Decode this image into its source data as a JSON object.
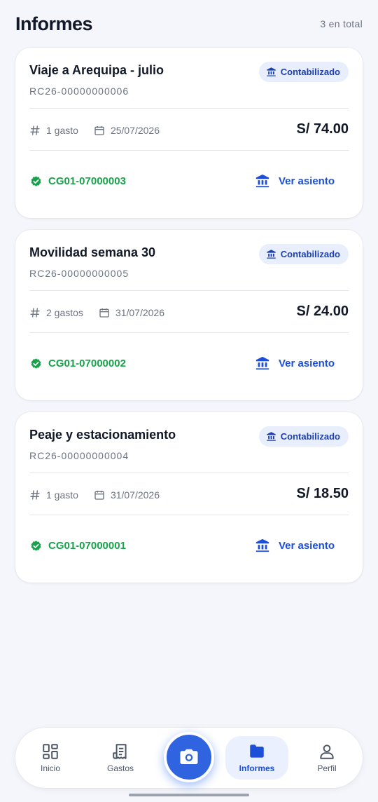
{
  "header": {
    "title": "Informes",
    "count": "3 en total"
  },
  "reports": [
    {
      "title": "Viaje a Arequipa - julio",
      "code": "RC26-00000000006",
      "status": "Contabilizado",
      "expenses": "1 gasto",
      "date": "25/07/2026",
      "amount": "S/ 74.00",
      "entry_code": "CG01-07000003",
      "action": "Ver asiento"
    },
    {
      "title": "Movilidad semana 30",
      "code": "RC26-00000000005",
      "status": "Contabilizado",
      "expenses": "2 gastos",
      "date": "31/07/2026",
      "amount": "S/ 24.00",
      "entry_code": "CG01-07000002",
      "action": "Ver asiento"
    },
    {
      "title": "Peaje y estacionamiento",
      "code": "RC26-00000000004",
      "status": "Contabilizado",
      "expenses": "1 gasto",
      "date": "31/07/2026",
      "amount": "S/ 18.50",
      "entry_code": "CG01-07000001",
      "action": "Ver asiento"
    }
  ],
  "nav": {
    "inicio": "Inicio",
    "gastos": "Gastos",
    "informes": "Informes",
    "perfil": "Perfil",
    "active": "informes"
  },
  "colors": {
    "accent": "#2f63e0",
    "success": "#16a34a",
    "badge_bg": "#e8eefc",
    "background": "#f4f6fb"
  },
  "icons": {
    "badge": "bank-icon",
    "expenses": "hash-icon",
    "date": "calendar-icon",
    "entry": "verified-check-icon",
    "action": "bank-icon",
    "camera": "camera-icon"
  }
}
